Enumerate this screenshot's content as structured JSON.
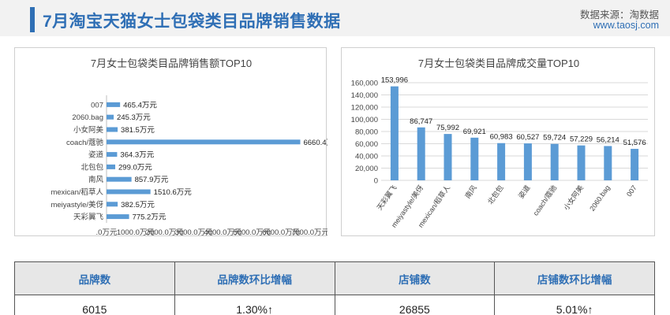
{
  "header": {
    "title": "7月淘宝天猫女士包袋类目品牌销售数据",
    "source_line": "数据来源：淘数据",
    "source_url": "www.taosj.com"
  },
  "colors": {
    "accent": "#2f6fb5",
    "bar": "#5b9bd5",
    "header_bg": "#f2f2f2"
  },
  "chart_data": [
    {
      "type": "bar",
      "orientation": "horizontal",
      "title": "7月女士包袋类目品牌销售额TOP10",
      "categories": [
        "007",
        "2060.bag",
        "小女阿美",
        "coach/蔻驰",
        "姿道",
        "北包包",
        "南风",
        "mexican/稻草人",
        "meiyastyle/美伢",
        "天彩翼飞"
      ],
      "values": [
        465.4,
        245.3,
        381.5,
        6660.4,
        364.3,
        299.0,
        857.9,
        1510.6,
        382.5,
        775.2
      ],
      "value_labels": [
        "465.4万元",
        "245.3万元",
        "381.5万元",
        "6660.4万元",
        "364.3万元",
        "299.0万元",
        "857.9万元",
        "1510.6万元",
        "382.5万元",
        "775.2万元"
      ],
      "x_ticks": [
        0,
        1000,
        2000,
        3000,
        4000,
        5000,
        6000,
        7000
      ],
      "x_tick_labels": [
        ".0万元",
        "1000.0万元",
        "2000.0万元",
        "3000.0万元",
        "4000.0万元",
        "5000.0万元",
        "6000.0万元",
        "7000.0万元"
      ],
      "xlim": [
        0,
        7000
      ],
      "grid": false
    },
    {
      "type": "bar",
      "orientation": "vertical",
      "title": "7月女士包袋类目品牌成交量TOP10",
      "categories": [
        "天彩翼飞",
        "meiyastyle/美伢",
        "mexican/稻草人",
        "南风",
        "北包包",
        "姿道",
        "coach/蔻驰",
        "小女阿美",
        "2060.bag",
        "007"
      ],
      "values": [
        153996,
        86747,
        75992,
        69921,
        60983,
        60527,
        59724,
        57229,
        56214,
        51576
      ],
      "value_labels": [
        "153,996",
        "86,747",
        "75,992",
        "69,921",
        "60,983",
        "60,527",
        "59,724",
        "57,229",
        "56,214",
        "51,576"
      ],
      "y_ticks": [
        0,
        20000,
        40000,
        60000,
        80000,
        100000,
        120000,
        140000,
        160000
      ],
      "y_tick_labels": [
        "0",
        "20,000",
        "40,000",
        "60,000",
        "80,000",
        "100,000",
        "120,000",
        "140,000",
        "160,000"
      ],
      "ylim": [
        0,
        160000
      ],
      "grid": true
    }
  ],
  "stats_table": {
    "headers": [
      "品牌数",
      "品牌数环比增幅",
      "店铺数",
      "店铺数环比增幅"
    ],
    "values": [
      "6015",
      "1.30%↑",
      "26855",
      "5.01%↑"
    ]
  }
}
